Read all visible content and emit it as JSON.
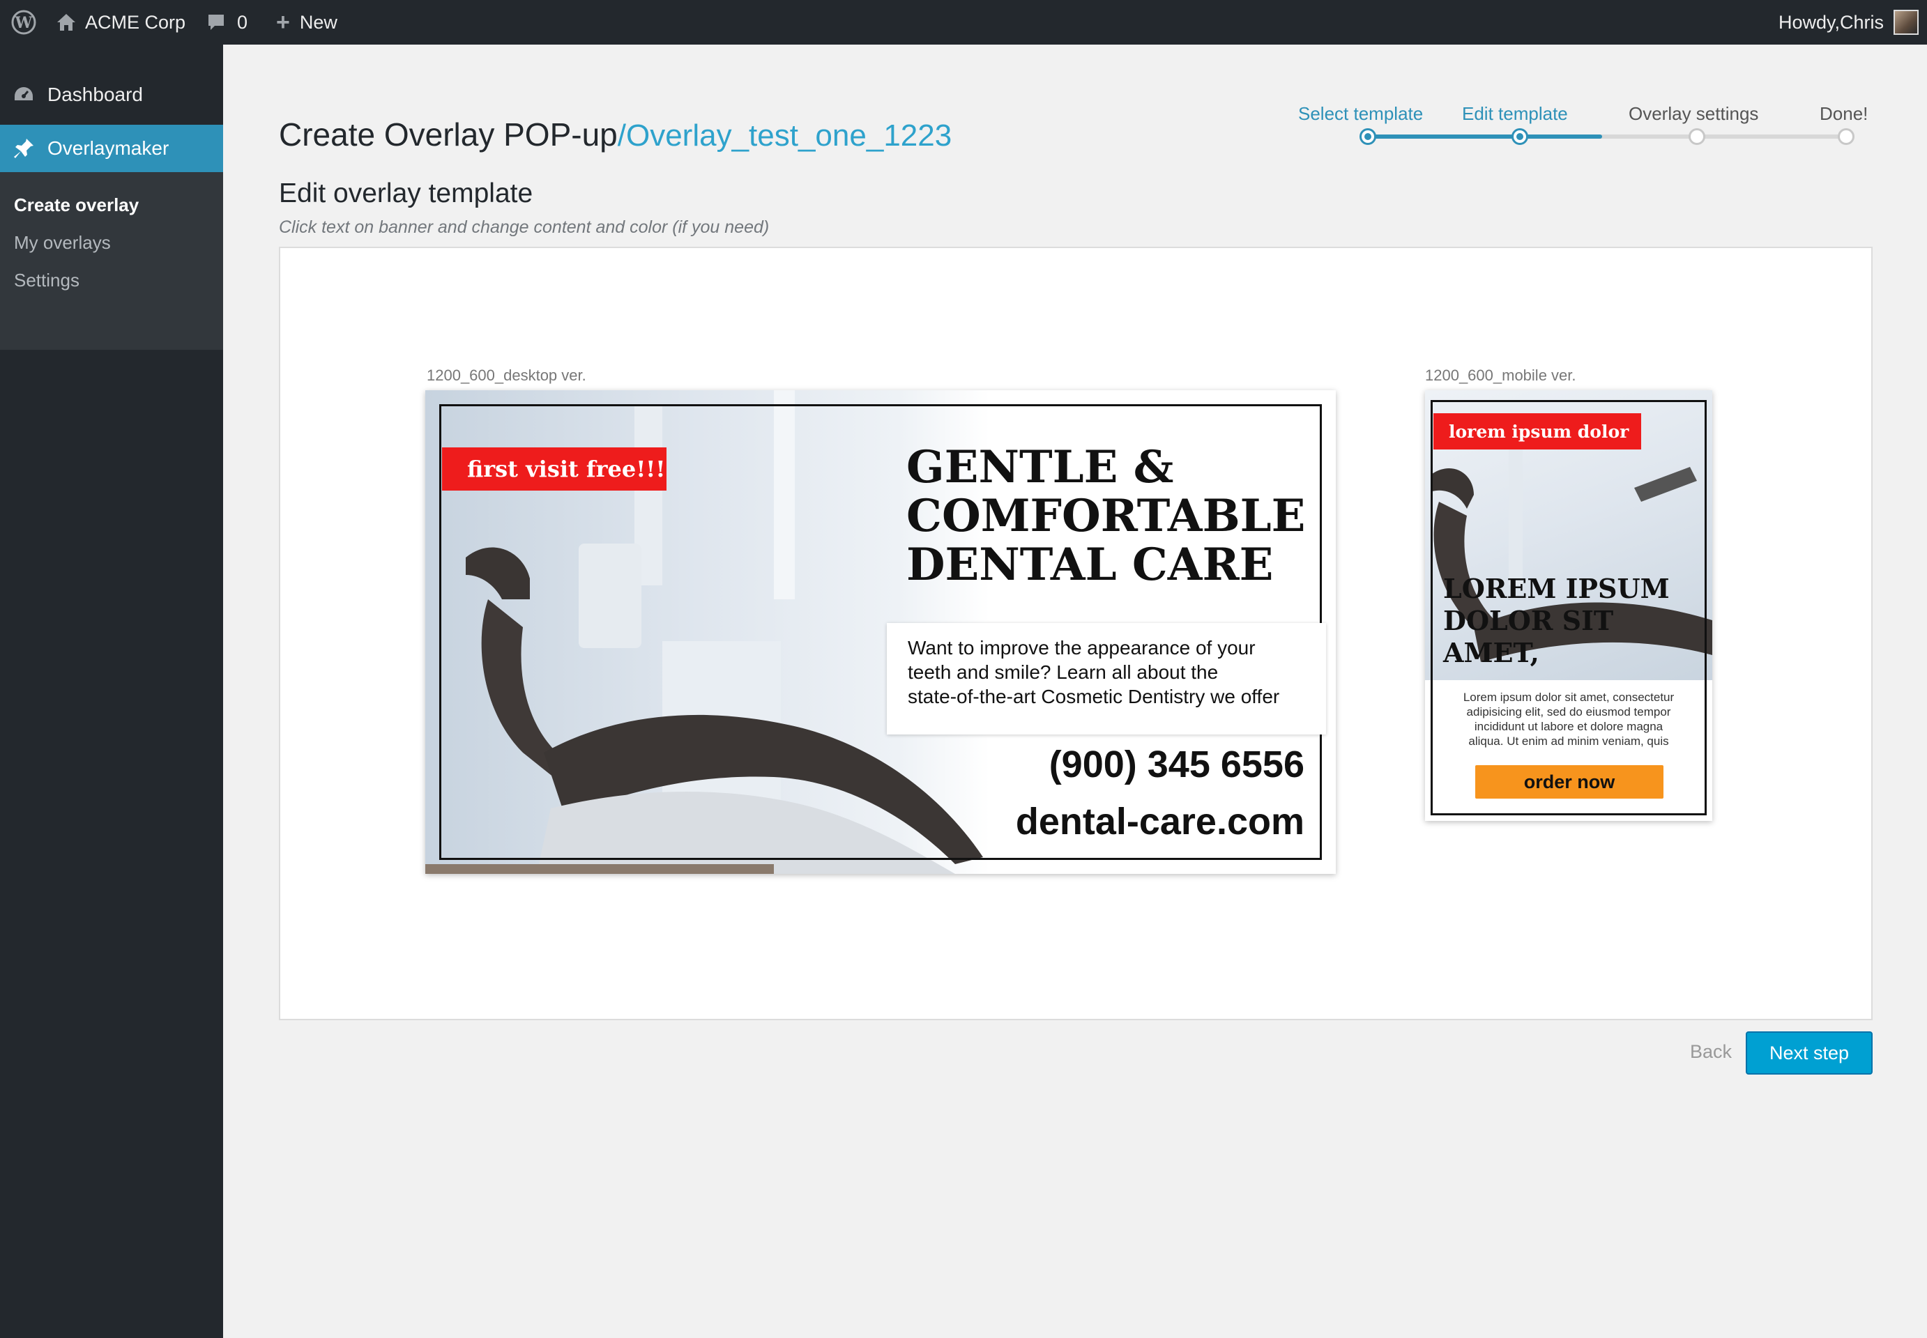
{
  "adminbar": {
    "site_name": "ACME Corp",
    "comments_count": "0",
    "new_label": "New",
    "howdy": "Howdy,Chris"
  },
  "sidebar": {
    "dashboard": "Dashboard",
    "plugin": "Overlaymaker",
    "submenu": [
      "Create overlay",
      "My overlays",
      "Settings"
    ]
  },
  "page": {
    "title": "Create Overlay POP-up",
    "overlay_name": "/Overlay_test_one_1223",
    "heading": "Edit overlay template",
    "hint": "Click text on banner and change content and color (if you need)"
  },
  "stepper": {
    "steps": [
      "Select template",
      "Edit template",
      "Overlay settings",
      "Done!"
    ]
  },
  "desktop": {
    "size_label": "1200_600_desktop ver.",
    "tag": "first visit free!!!",
    "headline": [
      "GENTLE &",
      "COMFORTABLE",
      "DENTAL CARE"
    ],
    "body": [
      "Want to improve the appearance of your",
      "teeth and smile? Learn all about the",
      "state-of-the-art Cosmetic Dentistry we offer"
    ],
    "phone": "(900) 345 6556",
    "url": "dental-care.com"
  },
  "mobile": {
    "size_label": "1200_600_mobile ver.",
    "tag": "lorem ipsum dolor",
    "headline": [
      "LOREM IPSUM",
      "DOLOR SIT",
      "AMET,"
    ],
    "body": [
      "Lorem ipsum dolor sit amet, consectetur",
      "adipisicing elit, sed do eiusmod tempor",
      "incididunt ut labore et dolore magna",
      "aliqua. Ut enim ad minim veniam, quis"
    ],
    "button": "order now"
  },
  "footer": {
    "back": "Back",
    "next": "Next step"
  },
  "colors": {
    "accent": "#2e91b8",
    "primary_button": "#00a0d2",
    "banner_red": "#ee1c1c",
    "order_orange": "#f7941d"
  }
}
